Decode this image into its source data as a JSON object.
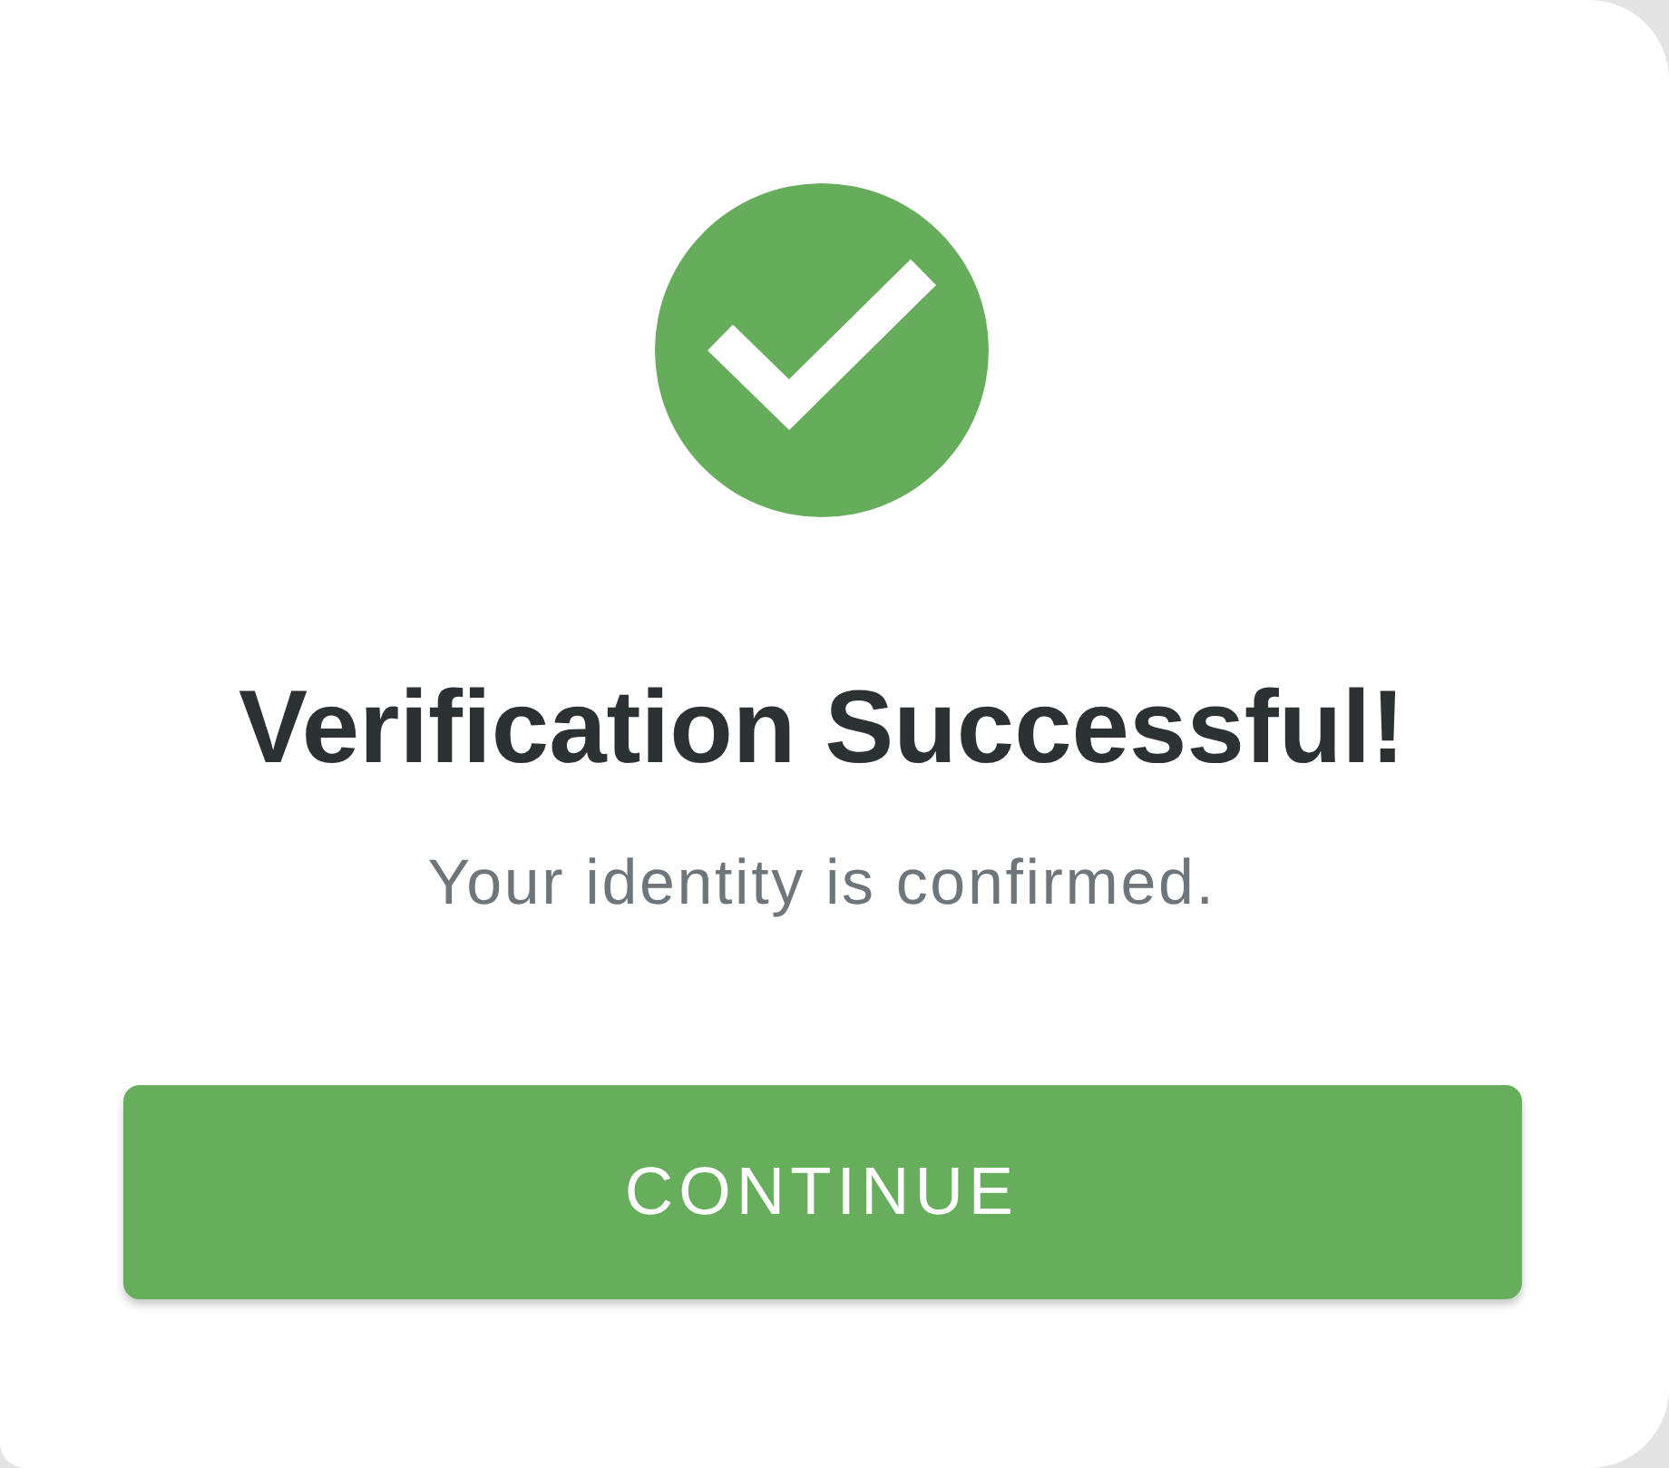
{
  "dialog": {
    "title": "Verification Successful!",
    "message": "Your identity is confirmed.",
    "button": {
      "label": "CONTINUE"
    }
  }
}
